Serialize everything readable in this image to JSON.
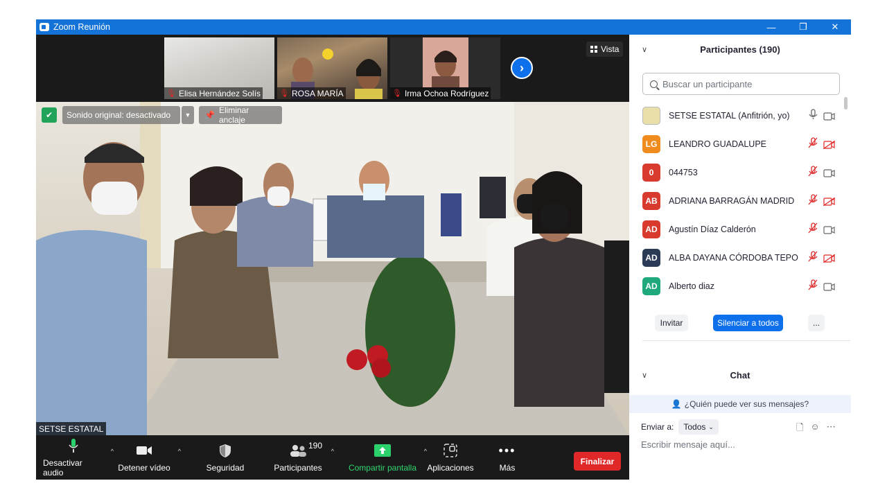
{
  "window": {
    "title": "Zoom Reunión",
    "controls": [
      "—",
      "❐",
      "✕"
    ]
  },
  "thumbnails": [
    {
      "name": "Elisa Hernández Solís"
    },
    {
      "name": "ROSA MARÍA"
    },
    {
      "name": "Irma Ochoa Rodríguez"
    }
  ],
  "view_button": {
    "label": "Vista"
  },
  "overlay": {
    "original_sound": "Sonido original: desactivado",
    "remove_pin": "Eliminar anclaje"
  },
  "speaker": {
    "name": "SETSE ESTATAL"
  },
  "toolbar": {
    "mute": "Desactivar audio",
    "video": "Detener vídeo",
    "security": "Seguridad",
    "participants": "Participantes",
    "participants_count": "190",
    "share": "Compartir pantalla",
    "apps": "Aplicaciones",
    "more": "Más",
    "end": "Finalizar"
  },
  "participants_panel": {
    "title": "Participantes (190)",
    "search_placeholder": "Buscar un participante",
    "participants": [
      {
        "initials": "",
        "name": "SETSE ESTATAL (Anfitrión, yo)",
        "color": "#e8e0a8",
        "mic": "on",
        "cam": "on"
      },
      {
        "initials": "LG",
        "name": "LEANDRO GUADALUPE",
        "color": "#f08c1e",
        "mic": "off",
        "cam": "off"
      },
      {
        "initials": "0",
        "name": "044753",
        "color": "#d83a2e",
        "mic": "off",
        "cam": "on"
      },
      {
        "initials": "AB",
        "name": "ADRIANA BARRAGÁN MADRID",
        "color": "#d83a2e",
        "mic": "off",
        "cam": "off"
      },
      {
        "initials": "AD",
        "name": "Agustín Díaz Calderón",
        "color": "#d83a2e",
        "mic": "off",
        "cam": "on"
      },
      {
        "initials": "AD",
        "name": "ALBA DAYANA CÓRDOBA TEPO",
        "color": "#2b3a55",
        "mic": "off",
        "cam": "off"
      },
      {
        "initials": "AD",
        "name": "Alberto diaz",
        "color": "#1fa87e",
        "mic": "off",
        "cam": "on"
      }
    ],
    "invite": "Invitar",
    "mute_all": "Silenciar a todos",
    "more": "..."
  },
  "chat": {
    "title": "Chat",
    "who_can_see": "¿Quién puede ver sus mensajes?",
    "send_to_label": "Enviar a:",
    "send_to_value": "Todos",
    "input_placeholder": "Escribir mensaje aquí..."
  },
  "colors": {
    "title_bar": "#1373d9",
    "end_button": "#e02828",
    "share_green": "#31d66f",
    "mute_all_blue": "#0e71eb",
    "muted_red": "#e02828"
  }
}
